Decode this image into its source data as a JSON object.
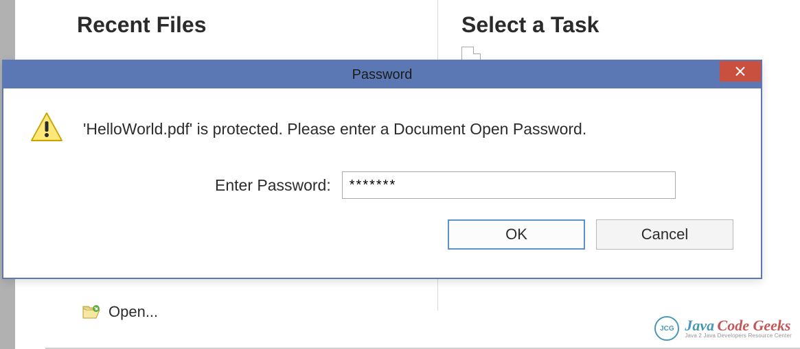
{
  "background": {
    "recent_files_heading": "Recent Files",
    "select_task_heading": "Select a Task",
    "open_label": "Open..."
  },
  "dialog": {
    "title": "Password",
    "message": "'HelloWorld.pdf' is protected. Please enter a Document Open Password.",
    "input_label": "Enter Password:",
    "input_value": "*******",
    "ok_label": "OK",
    "cancel_label": "Cancel"
  },
  "watermark": {
    "brand_primary": "Java",
    "brand_secondary": "Code Geeks",
    "subtitle": "Java 2 Java Developers Resource Center",
    "badge": "JCG"
  }
}
